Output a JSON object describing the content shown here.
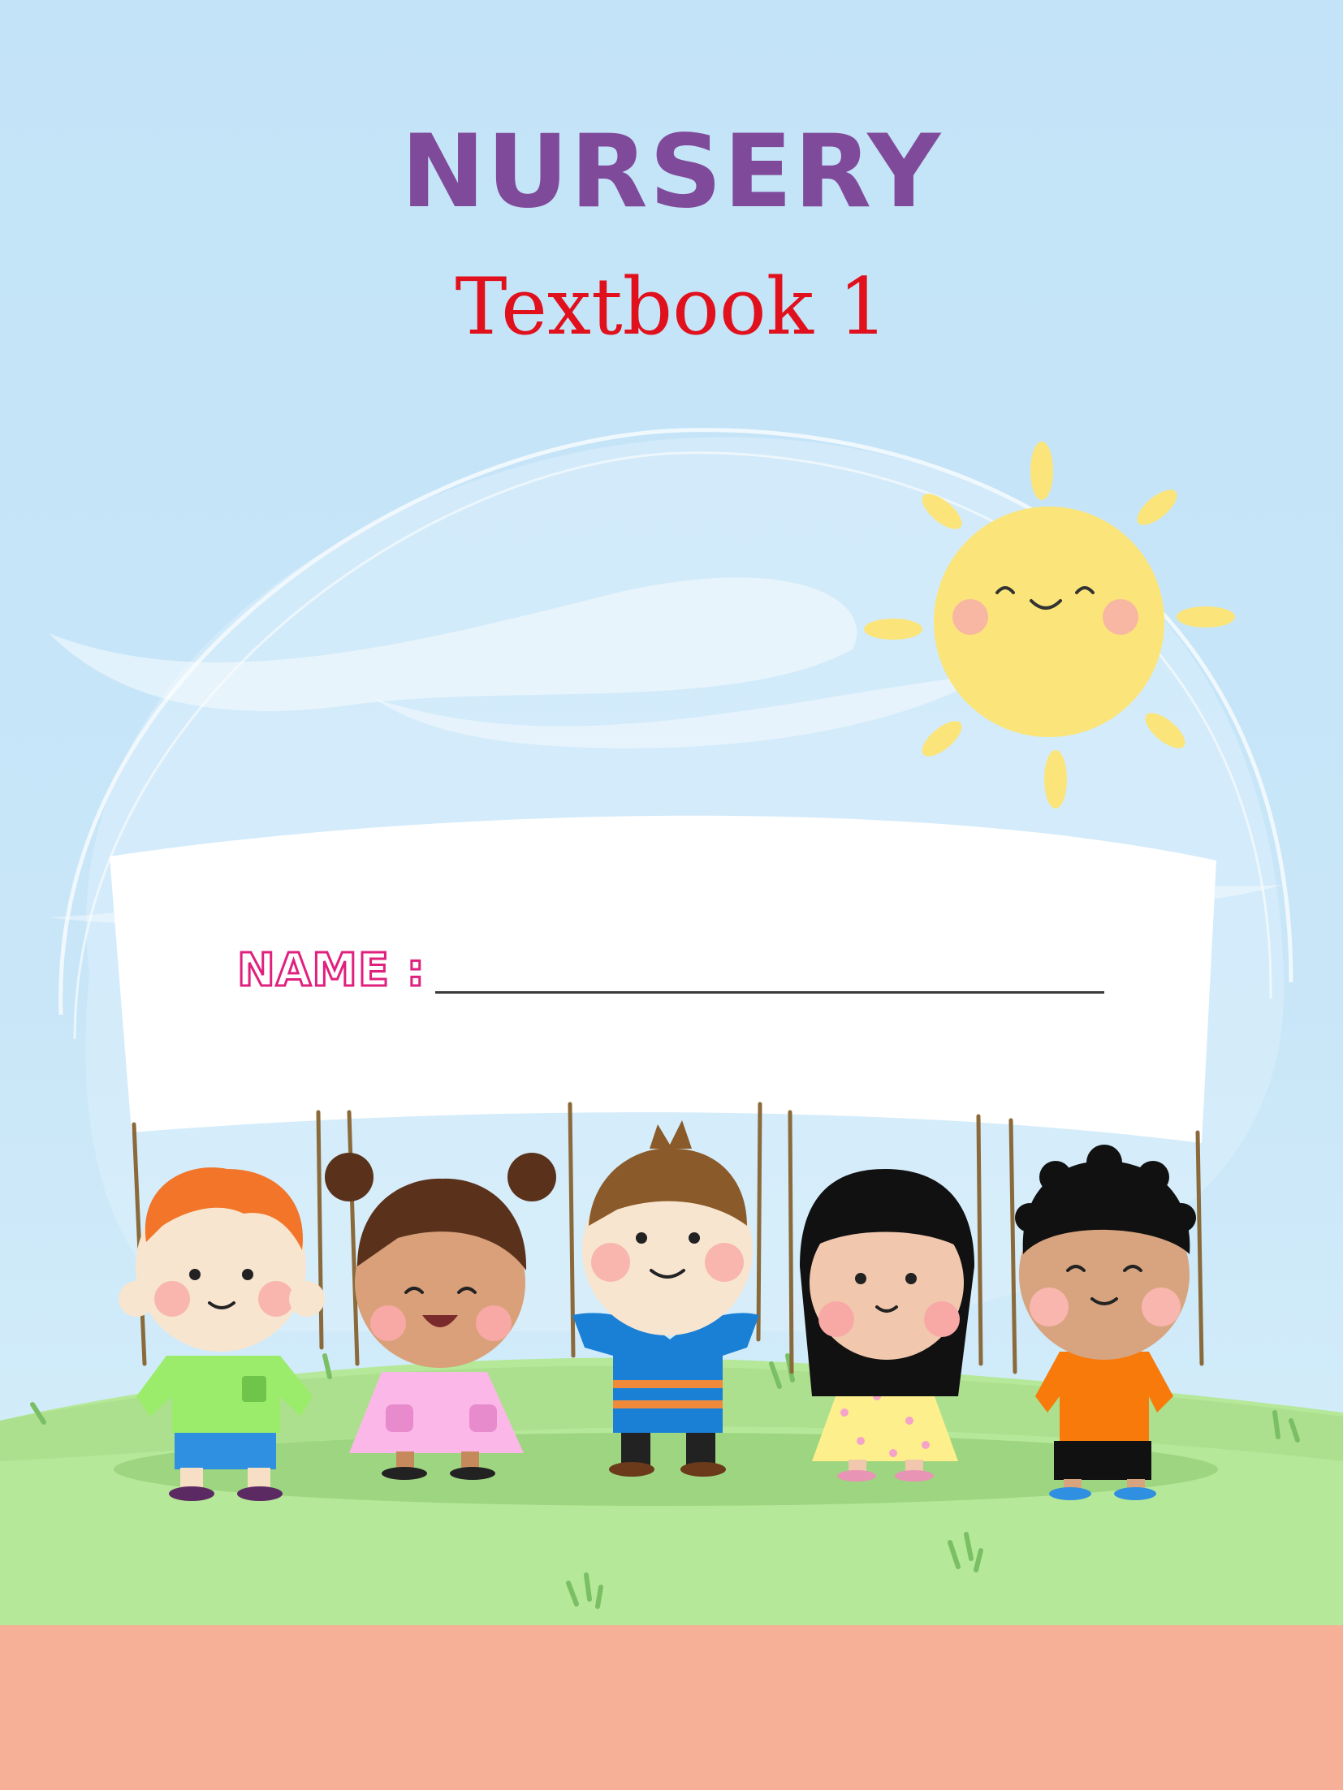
{
  "cover": {
    "title": "NURSERY",
    "subtitle": "Textbook 1",
    "name_label": "NAME :"
  },
  "colors": {
    "sky": "#c5e4f8",
    "title": "#804a9a",
    "subtitle": "#e0101d",
    "name_label": "#e0207e",
    "grass": "#b5e898",
    "footer": "#f6b097",
    "sun": "#fbe57a"
  },
  "illustration": {
    "elements": [
      "sun-icon",
      "banner",
      "children-group",
      "grass-hill"
    ]
  }
}
